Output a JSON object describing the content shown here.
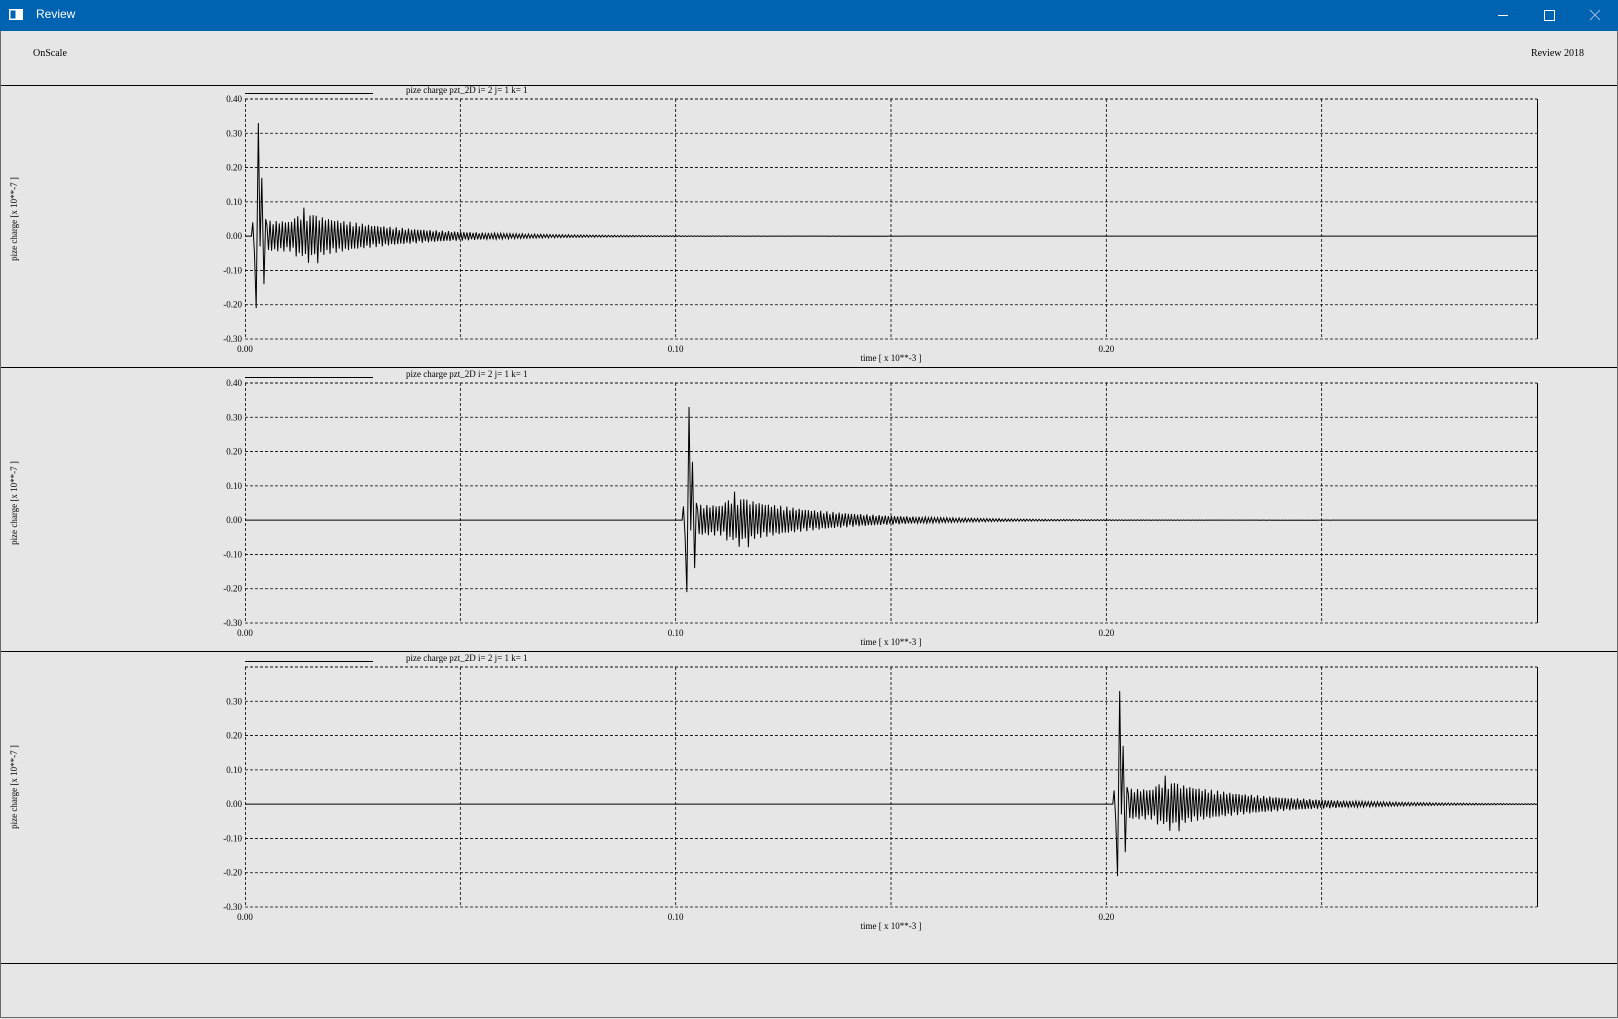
{
  "window": {
    "title": "Review",
    "icon": "window-app-icon",
    "controls": [
      "minimize-icon",
      "maximize-icon",
      "close-icon"
    ]
  },
  "header": {
    "left_label": "OnScale",
    "right_label": "Review 2018"
  },
  "chart_data": [
    {
      "type": "line",
      "title": "pize charge pzt_2D i= 2 j= 1 k= 1",
      "xlabel": "time [ x 10**-3 ]",
      "ylabel": "pize charge [x 10**-7 ]",
      "xlim": [
        0.0,
        0.3
      ],
      "ylim": [
        -0.3,
        0.4
      ],
      "xticks": [
        "0.00",
        "0.10",
        "0.20"
      ],
      "yticks": [
        "0.40",
        "0.30",
        "0.20",
        "0.10",
        "0.00",
        "-0.10",
        "-0.20",
        "-0.30"
      ],
      "grid": true,
      "series_color": "#000000",
      "pulse_onset": 0.0015,
      "peaks": {
        "max": 0.33,
        "min": -0.21
      }
    },
    {
      "type": "line",
      "title": "pize charge pzt_2D i= 2 j= 1 k= 1",
      "xlabel": "time [ x 10**-3 ]",
      "ylabel": "pize charge [x 10**-7 ]",
      "xlim": [
        0.0,
        0.3
      ],
      "ylim": [
        -0.3,
        0.4
      ],
      "xticks": [
        "0.00",
        "0.10",
        "0.20"
      ],
      "yticks": [
        "0.40",
        "0.30",
        "0.20",
        "0.10",
        "0.00",
        "-0.10",
        "-0.20",
        "-0.30"
      ],
      "grid": true,
      "series_color": "#000000",
      "pulse_onset": 0.1015,
      "peaks": {
        "max": 0.33,
        "min": -0.21
      }
    },
    {
      "type": "line",
      "title": "pize charge pzt_2D i= 2 j= 1 k= 1",
      "xlabel": "time [ x 10**-3 ]",
      "ylabel": "pize charge [x 10**-7 ]",
      "xlim": [
        0.0,
        0.3
      ],
      "ylim": [
        -0.3,
        0.4
      ],
      "xticks": [
        "0.00",
        "0.10",
        "0.20"
      ],
      "yticks": [
        "",
        "0.30",
        "0.20",
        "0.10",
        "0.00",
        "-0.10",
        "-0.20",
        "-0.30"
      ],
      "grid": true,
      "series_color": "#000000",
      "pulse_onset": 0.2015,
      "peaks": {
        "max": 0.33,
        "min": -0.21
      }
    }
  ]
}
